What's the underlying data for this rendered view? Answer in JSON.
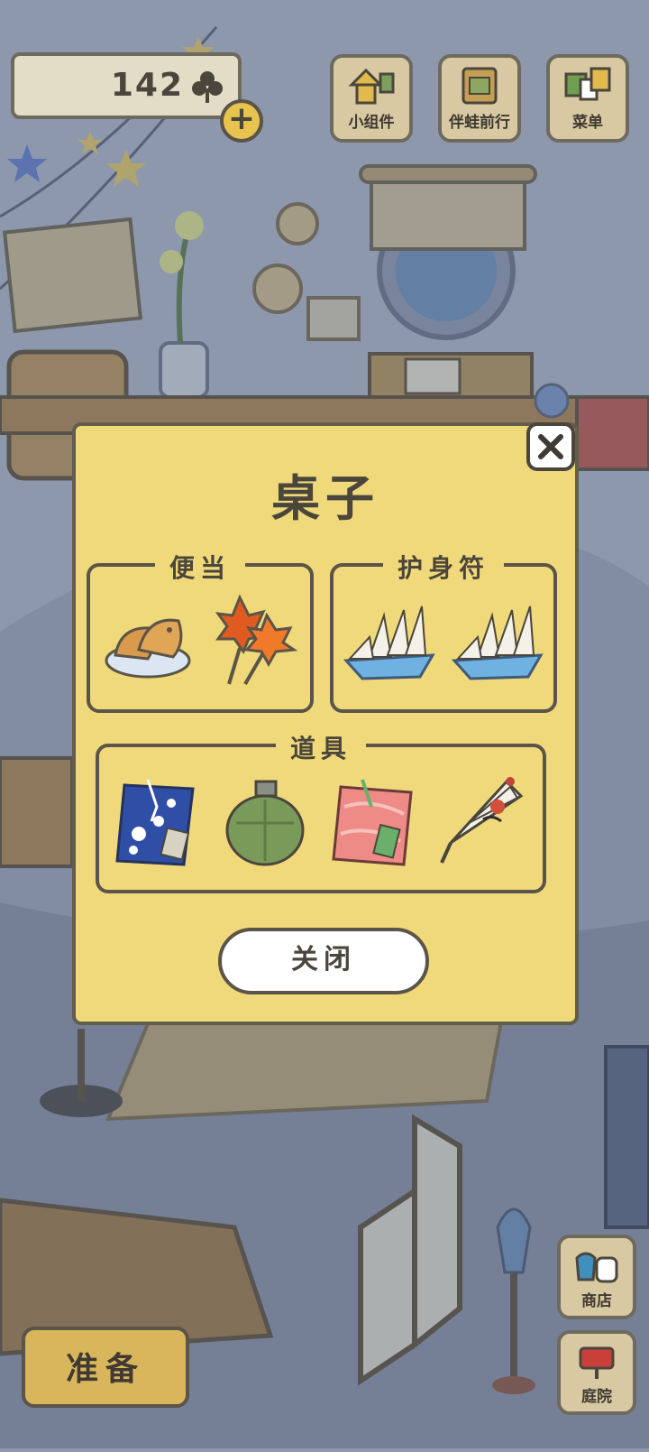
{
  "hud": {
    "clover_count": "142",
    "plus_label": "+"
  },
  "top_buttons": [
    {
      "label": "小组件",
      "icon": "widget-icon"
    },
    {
      "label": "伴蛙前行",
      "icon": "journey-icon"
    },
    {
      "label": "菜单",
      "icon": "menu-icon"
    }
  ],
  "dialog": {
    "title": "桌子",
    "sections": [
      {
        "label": "便当",
        "items": [
          "taiyaki-icon",
          "maple-tempura-icon"
        ]
      },
      {
        "label": "护身符",
        "items": [
          "paper-ship-icon",
          "paper-ship-icon"
        ]
      },
      {
        "label": "道具",
        "items": [
          "blue-cloth-icon",
          "canteen-icon",
          "pink-cloth-icon",
          "paper-umbrella-icon"
        ]
      }
    ],
    "close_label": "关闭"
  },
  "bottom": {
    "prepare_label": "准备",
    "shop_label": "商店",
    "yard_label": "庭院"
  }
}
